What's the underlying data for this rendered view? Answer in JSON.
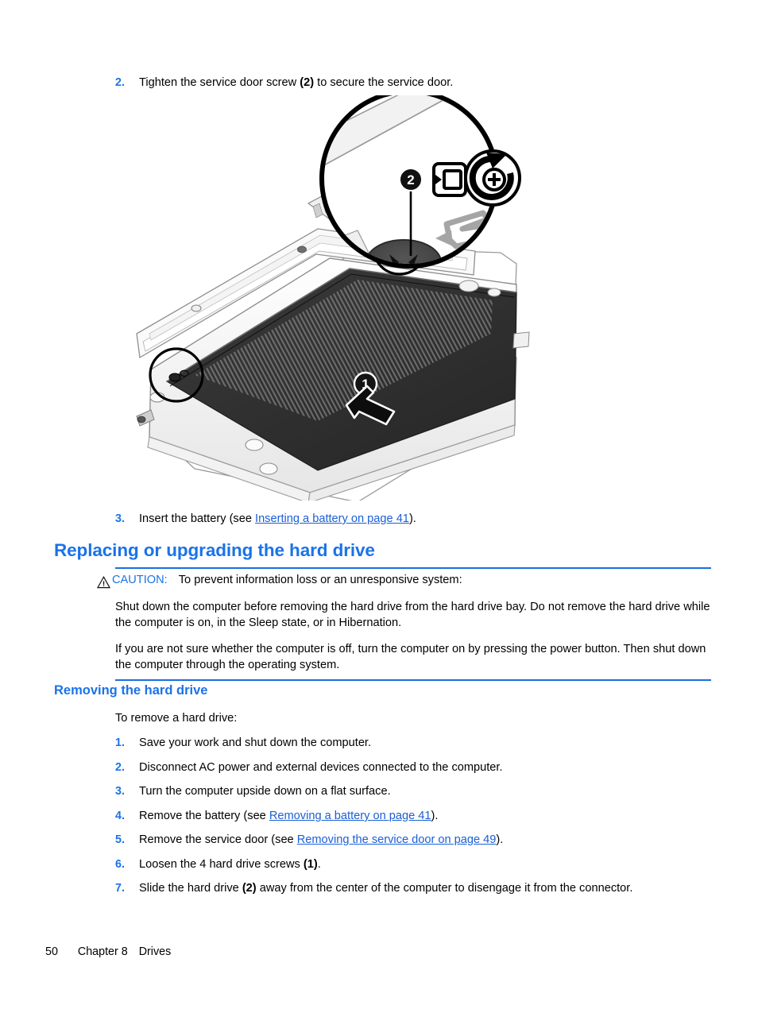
{
  "document": {
    "steps_top": [
      {
        "num": "2.",
        "text_before": "Tighten the service door screw ",
        "bold": "(2)",
        "text_after": " to secure the service door."
      }
    ],
    "step_insert_battery": {
      "num": "3.",
      "text_before": "Insert the battery (see ",
      "link": "Inserting a battery on page 41",
      "text_after": ")."
    },
    "heading_main": "Replacing or upgrading the hard drive",
    "caution": {
      "label": "CAUTION:",
      "lead": "To prevent information loss or an unresponsive system:",
      "paragraph_1": "Shut down the computer before removing the hard drive from the hard drive bay. Do not remove the hard drive while the computer is on, in the Sleep state, or in Hibernation.",
      "paragraph_2": "If you are not sure whether the computer is off, turn the computer on by pressing the power button. Then shut down the computer through the operating system.",
      "icon": "warning-triangle-icon",
      "rule_color": "#1a6fe0",
      "label_color": "#1a73e8"
    },
    "heading_sub": "Removing the hard drive",
    "intro": "To remove a hard drive:",
    "steps": [
      {
        "num": "1.",
        "text_before": "Save your work and shut down the computer.",
        "bold": "",
        "text_after": "",
        "link": ""
      },
      {
        "num": "2.",
        "text_before": "Disconnect AC power and external devices connected to the computer.",
        "bold": "",
        "text_after": "",
        "link": ""
      },
      {
        "num": "3.",
        "text_before": "Turn the computer upside down on a flat surface.",
        "bold": "",
        "text_after": "",
        "link": ""
      },
      {
        "num": "4.",
        "text_before": "Remove the battery (see ",
        "bold": "",
        "link": "Removing a battery on page 41",
        "text_after": ")."
      },
      {
        "num": "5.",
        "text_before": "Remove the service door (see ",
        "bold": "",
        "link": "Removing the service door on page 49",
        "text_after": ")."
      },
      {
        "num": "6.",
        "text_before": "Loosen the 4 hard drive screws ",
        "bold": "(1)",
        "link": "",
        "text_after": "."
      },
      {
        "num": "7.",
        "text_before": "Slide the hard drive ",
        "bold": "(2)",
        "link": "",
        "text_after": " away from the center of the computer to disengage it from the connector."
      }
    ],
    "footer": {
      "page_number": "50",
      "chapter": "Chapter 8",
      "chapter_title": "Drives"
    },
    "figure": {
      "description": "Bottom view of a laptop with the service door and battery, a magnified callout circle showing the service door screw",
      "callout_1": "1",
      "callout_2": "2",
      "icons": [
        "lock-insert-icon",
        "rotate-tighten-icon",
        "screw-head-icon",
        "slide-arrow-icon"
      ]
    },
    "colors": {
      "heading_blue": "#1a73e8",
      "link_blue": "#1a5fd6",
      "text_black": "#000000",
      "rule_blue": "#1a6fe0"
    }
  }
}
